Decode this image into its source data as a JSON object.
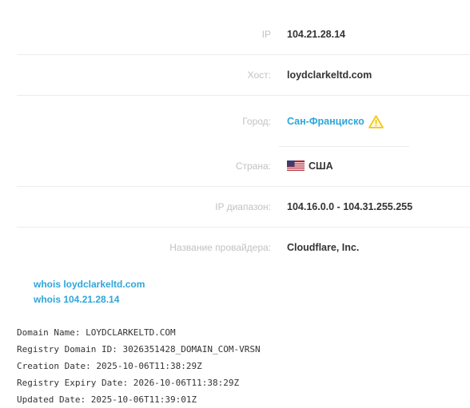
{
  "info": [
    {
      "label": "IP",
      "value": "104.21.28.14"
    },
    {
      "label": "Хост:",
      "value": "loydclarkeltd.com"
    },
    {
      "label": "Город:",
      "value": "Сан-Франциско",
      "icon": "warning-icon"
    },
    {
      "label": "Страна:",
      "value": "США",
      "icon": "us-flag-icon"
    },
    {
      "label": "IP диапазон:",
      "value": "104.16.0.0 - 104.31.255.255"
    },
    {
      "label": "Название провайдера:",
      "value": "Cloudflare, Inc."
    }
  ],
  "whois_links": [
    "whois loydclarkeltd.com",
    "whois 104.21.28.14"
  ],
  "whois_output": [
    "Domain Name: LOYDCLARKELTD.COM",
    "Registry Domain ID: 3026351428_DOMAIN_COM-VRSN",
    "Creation Date: 2025-10-06T11:38:29Z",
    "Registry Expiry Date: 2026-10-06T11:38:29Z",
    "Updated Date: 2025-10-06T11:39:01Z"
  ],
  "colors": {
    "label": "#c2c2c2",
    "value": "#333333",
    "link": "#2fa6da",
    "warning": "#f2c200",
    "divider": "#ececec"
  }
}
